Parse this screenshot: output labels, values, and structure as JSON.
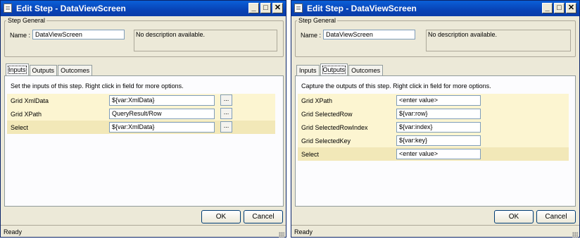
{
  "windows": [
    {
      "title": "Edit Step - DataViewScreen",
      "group_label": "Step General",
      "name_label": "Name :",
      "name_value": "DataViewScreen",
      "description": "No description available.",
      "tabs": [
        "Inputs",
        "Outputs",
        "Outcomes"
      ],
      "active_tab": "Inputs",
      "help_text": "Set the inputs of this step.  Right click in field for more options.",
      "rows": [
        {
          "label": "Grid XmlData",
          "value": "${var:XmlData}",
          "browse": "..."
        },
        {
          "label": "Grid XPath",
          "value": "QueryResult/Row",
          "browse": "..."
        },
        {
          "label": "Select",
          "value": "${var:XmlData}",
          "browse": "..."
        }
      ],
      "ok_label": "OK",
      "cancel_label": "Cancel",
      "status": "Ready"
    },
    {
      "title": "Edit Step - DataViewScreen",
      "group_label": "Step General",
      "name_label": "Name :",
      "name_value": "DataViewScreen",
      "description": "No description available.",
      "tabs": [
        "Inputs",
        "Outputs",
        "Outcomes"
      ],
      "active_tab": "Outputs",
      "help_text": "Capture the outputs of this step.  Right click in field for more options.",
      "rows": [
        {
          "label": "Grid XPath",
          "value": "<enter value>"
        },
        {
          "label": "Grid SelectedRow",
          "value": "${var:row}"
        },
        {
          "label": "Grid SelectedRowIndex",
          "value": "${var:index}"
        },
        {
          "label": "Grid SelectedKey",
          "value": "${var:key}"
        },
        {
          "label": "Select",
          "value": "<enter value>"
        }
      ],
      "ok_label": "OK",
      "cancel_label": "Cancel",
      "status": "Ready"
    }
  ],
  "title_buttons": {
    "minimize": "_",
    "maximize": "□",
    "close": "✕"
  },
  "colors": {
    "titlebar": "#0a4fc8",
    "window_bg": "#ece9d8",
    "row_bg": "#fcf5d1",
    "row_selected_bg": "#f2e8b8"
  }
}
